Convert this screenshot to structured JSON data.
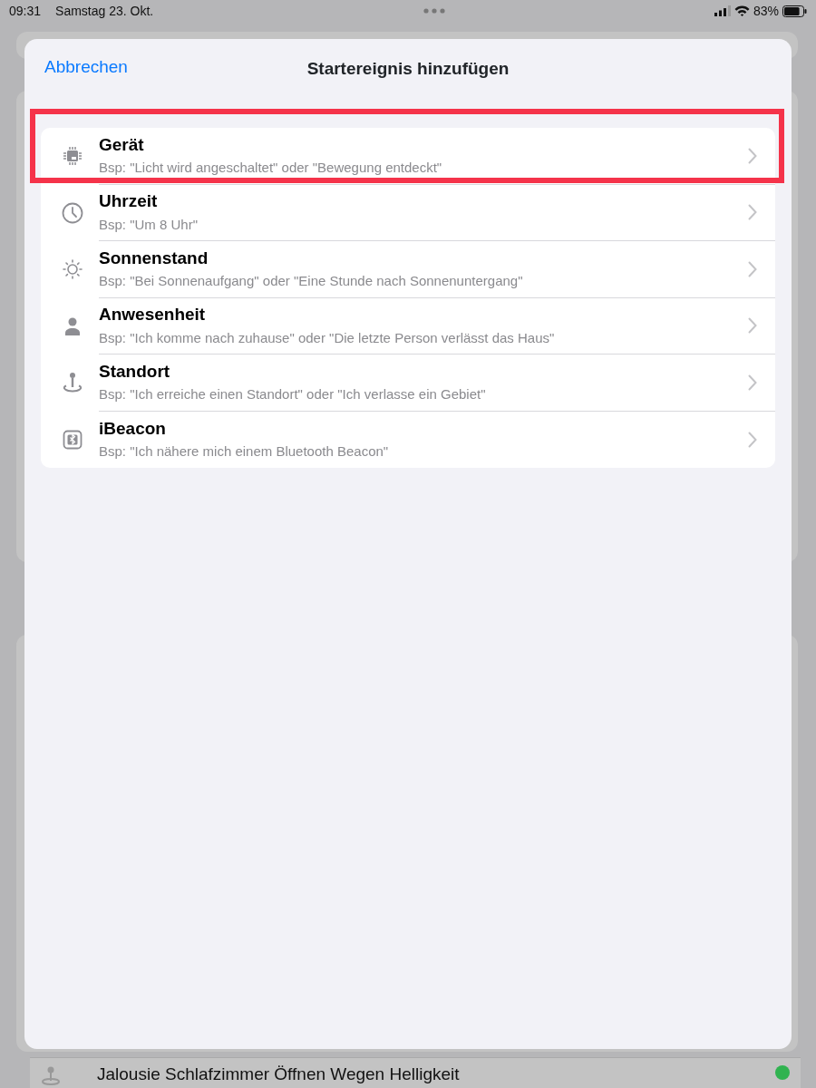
{
  "status_bar": {
    "time": "09:31",
    "date": "Samstag 23. Okt.",
    "battery": "83%"
  },
  "dialog": {
    "cancel": "Abbrechen",
    "title": "Startereignis hinzufügen",
    "items": [
      {
        "kind": "device",
        "title": "Gerät",
        "subtitle": "Bsp: \"Licht wird angeschaltet\" oder \"Bewegung entdeckt\"",
        "highlighted": true
      },
      {
        "kind": "time",
        "title": "Uhrzeit",
        "subtitle": "Bsp: \"Um 8 Uhr\"",
        "highlighted": false
      },
      {
        "kind": "sun",
        "title": "Sonnenstand",
        "subtitle": "Bsp: \"Bei Sonnenaufgang\" oder \"Eine Stunde nach Sonnenuntergang\"",
        "highlighted": false
      },
      {
        "kind": "presence",
        "title": "Anwesenheit",
        "subtitle": "Bsp: \"Ich komme nach zuhause\" oder \"Die letzte Person verlässt das Haus\"",
        "highlighted": false
      },
      {
        "kind": "location",
        "title": "Standort",
        "subtitle": "Bsp: \"Ich erreiche einen Standort\" oder \"Ich verlasse ein Gebiet\"",
        "highlighted": false
      },
      {
        "kind": "beacon",
        "title": "iBeacon",
        "subtitle": "Bsp: \"Ich nähere mich einem Bluetooth Beacon\"",
        "highlighted": false
      }
    ]
  },
  "background_row": {
    "title": "Jalousie Schlafzimmer Öffnen Wegen Helligkeit",
    "color": "#30b350"
  }
}
